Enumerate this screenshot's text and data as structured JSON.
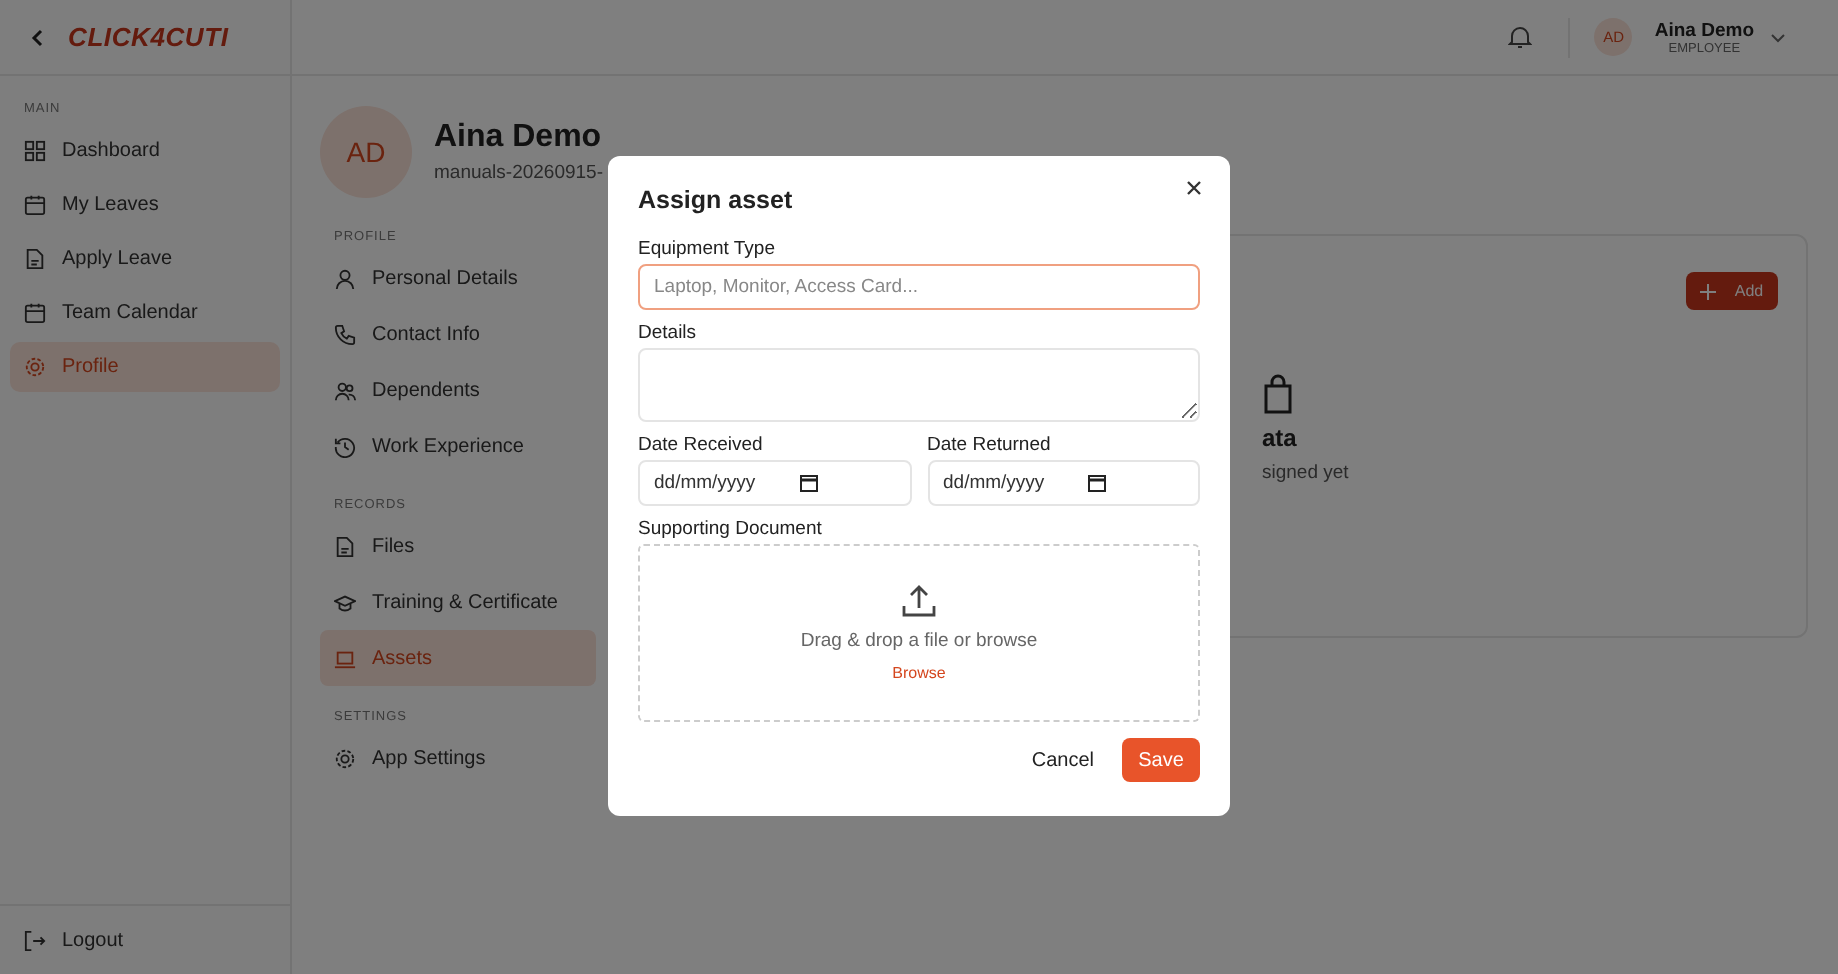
{
  "header": {
    "logo": "CLICK4CUTI",
    "user": {
      "initials": "AD",
      "name": "Aina Demo",
      "role": "EMPLOYEE"
    }
  },
  "sidebar": {
    "section": "MAIN",
    "items": [
      {
        "label": "Dashboard",
        "selected": false
      },
      {
        "label": "My Leaves",
        "selected": false
      },
      {
        "label": "Apply Leave",
        "selected": false
      },
      {
        "label": "Team Calendar",
        "selected": false
      },
      {
        "label": "Profile",
        "selected": true
      }
    ],
    "logout": "Logout"
  },
  "profile": {
    "initials": "AD",
    "name": "Aina Demo",
    "subtitle": "manuals-20260915-"
  },
  "subnav": [
    {
      "title": "PROFILE",
      "items": [
        {
          "label": "Personal Details",
          "selected": false
        },
        {
          "label": "Contact Info",
          "selected": false
        },
        {
          "label": "Dependents",
          "selected": false
        },
        {
          "label": "Work Experience",
          "selected": false
        }
      ]
    },
    {
      "title": "RECORDS",
      "items": [
        {
          "label": "Files",
          "selected": false
        },
        {
          "label": "Training & Certificate",
          "selected": false
        },
        {
          "label": "Assets",
          "selected": true
        }
      ]
    },
    {
      "title": "SETTINGS",
      "items": [
        {
          "label": "App Settings",
          "selected": false
        }
      ]
    }
  ],
  "card": {
    "add_button": "Add",
    "empty_title": "ata",
    "empty_text": "signed yet"
  },
  "modal": {
    "title": "Assign asset",
    "equipment_type": {
      "label": "Equipment Type",
      "placeholder": "Laptop, Monitor, Access Card..."
    },
    "details": {
      "label": "Details"
    },
    "date_received": {
      "label": "Date Received",
      "placeholder": "dd/mm/yyyy"
    },
    "date_returned": {
      "label": "Date Returned",
      "placeholder": "dd/mm/yyyy"
    },
    "document": {
      "label": "Supporting Document",
      "hint": "Drag & drop a file or browse",
      "browse": "Browse"
    },
    "buttons": {
      "cancel": "Cancel",
      "save": "Save"
    }
  }
}
